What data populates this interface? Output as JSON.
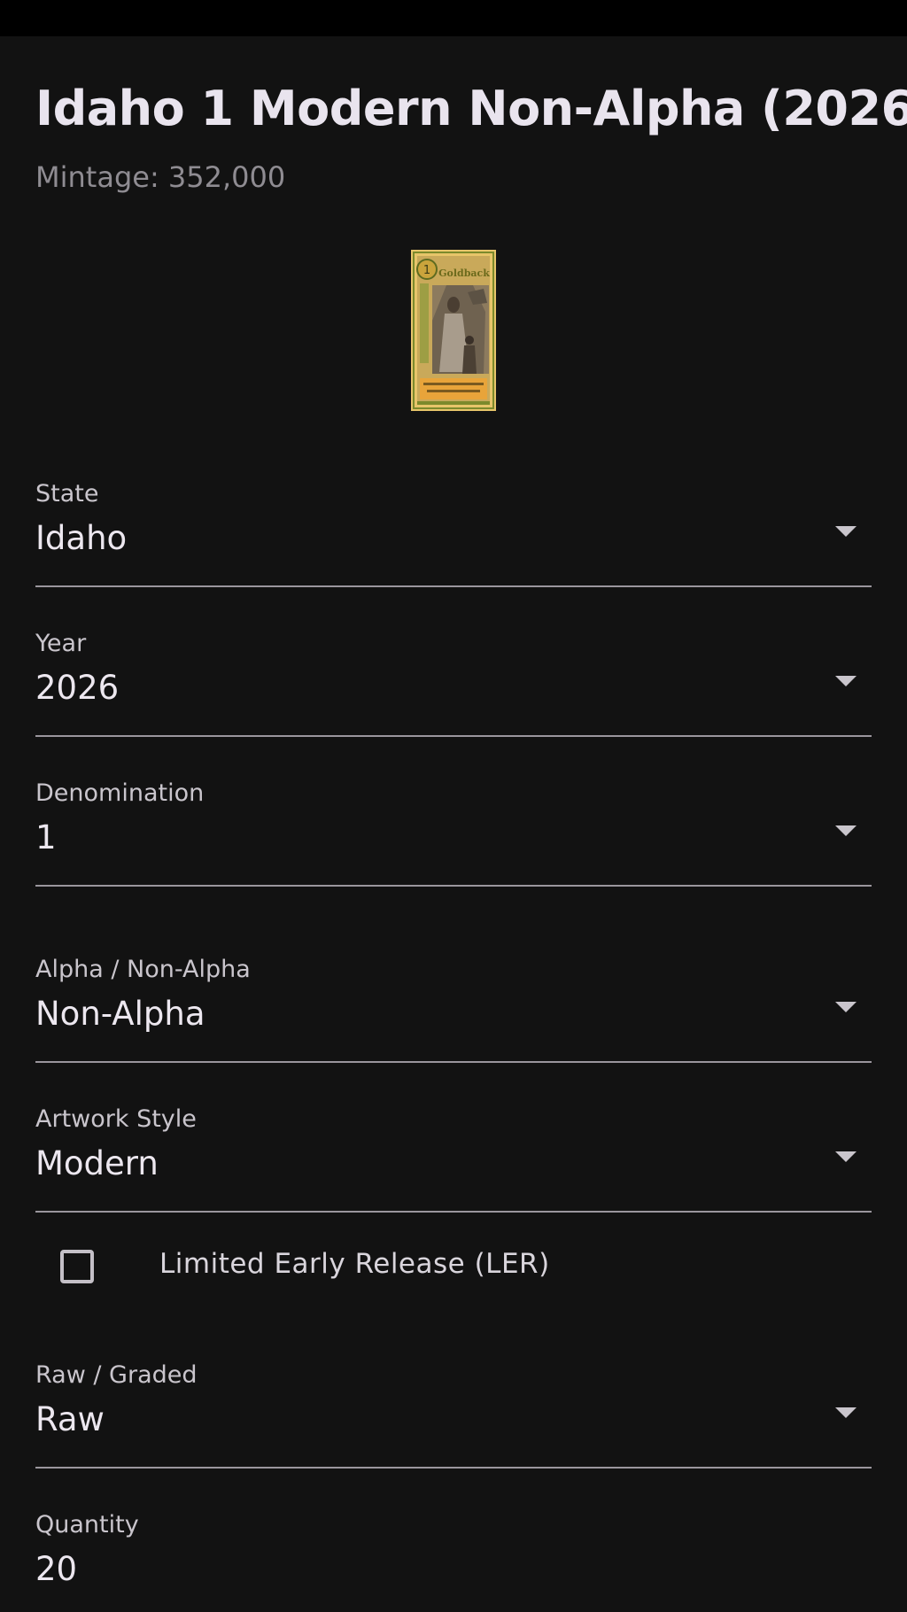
{
  "header": {
    "title": "Idaho 1 Modern Non-Alpha (2026)",
    "mintage": "Mintage: 352,000"
  },
  "image": {
    "alt_text": "Idaho Goldback note",
    "logo_text": "Goldback"
  },
  "fields": {
    "state": {
      "label": "State",
      "value": "Idaho"
    },
    "year": {
      "label": "Year",
      "value": "2026"
    },
    "denomination": {
      "label": "Denomination",
      "value": "1"
    },
    "alpha": {
      "label": "Alpha / Non-Alpha",
      "value": "Non-Alpha"
    },
    "artwork": {
      "label": "Artwork Style",
      "value": "Modern"
    },
    "ler": {
      "label": "Limited Early Release (LER)",
      "checked": false
    },
    "raw_graded": {
      "label": "Raw / Graded",
      "value": "Raw"
    },
    "quantity": {
      "label": "Quantity",
      "value": "20"
    }
  },
  "icons": {
    "dropdown": "arrow-drop-down-icon",
    "checkbox": "checkbox-unchecked-icon"
  },
  "colors": {
    "background": "#121212",
    "status_bar": "#000000",
    "text_primary": "#ece7ef",
    "text_secondary": "#8f8c92",
    "underline": "#9a969d",
    "note_gold": "#d9b45a"
  }
}
